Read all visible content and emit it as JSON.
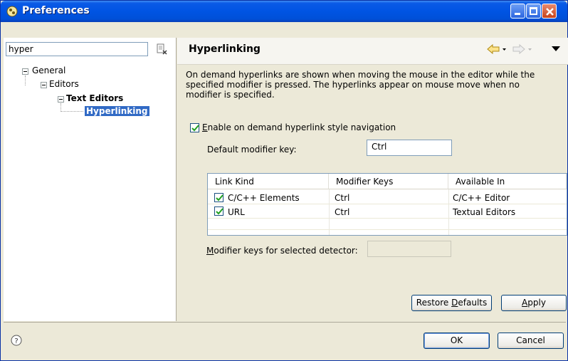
{
  "window": {
    "title": "Preferences"
  },
  "filter": {
    "value": "hyper"
  },
  "tree": {
    "nodes": [
      {
        "label": "General"
      },
      {
        "label": "Editors"
      },
      {
        "label": "Text Editors"
      },
      {
        "label": "Hyperlinking"
      }
    ]
  },
  "page": {
    "title": "Hyperlinking",
    "description": "On demand hyperlinks are shown when moving the mouse in the editor while the specified modifier is pressed. The hyperlinks appear on mouse move when no modifier is specified.",
    "enable_checkbox": {
      "label_first": "E",
      "label_rest": "nable on demand hyperlink style navigation",
      "checked": true
    },
    "default_modifier_label": "Default modifier key:",
    "default_modifier_value": "Ctrl",
    "table": {
      "columns": [
        "Link Kind",
        "Modifier Keys",
        "Available In"
      ],
      "rows": [
        {
          "kind": "C/C++ Elements",
          "modifier": "Ctrl",
          "available": "C/C++ Editor",
          "checked": true
        },
        {
          "kind": "URL",
          "modifier": "Ctrl",
          "available": "Textual Editors",
          "checked": true
        }
      ]
    },
    "selected_modifier_label_first": "M",
    "selected_modifier_label_rest": "odifier keys for selected detector:",
    "selected_modifier_value": ""
  },
  "buttons": {
    "restore_first": "Restore ",
    "restore_mn": "D",
    "restore_rest": "efaults",
    "apply_mn": "A",
    "apply_rest": "pply",
    "ok": "OK",
    "cancel": "Cancel"
  },
  "icons": {
    "app": "eclipse-icon",
    "clear": "clear-filter-icon",
    "back": "back-arrow-icon",
    "forward": "forward-arrow-icon",
    "menu": "view-menu-icon",
    "help": "help-icon"
  }
}
